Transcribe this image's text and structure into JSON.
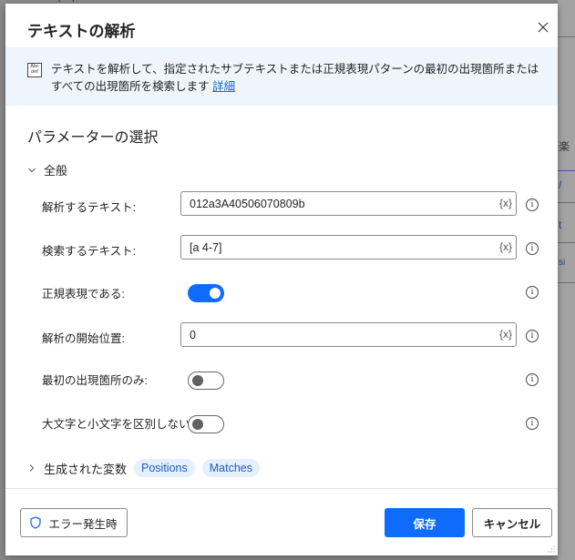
{
  "background": {
    "top_label": "[def]",
    "right_strip_texts": [
      "楽",
      "/",
      "t",
      "si"
    ]
  },
  "dialog": {
    "title": "テキストの解析",
    "close_icon": "close-icon",
    "banner": {
      "icon": "abc-def-icon",
      "icon_text_top": "Abc",
      "icon_text_bottom": "def",
      "description": "テキストを解析して、指定されたサブテキストまたは正規表現パターンの最初の出現箇所またはすべての出現箇所を検索します",
      "link_label": "詳細"
    },
    "section_title": "パラメーターの選択",
    "group": {
      "label": "全般",
      "expanded": true
    },
    "fields": {
      "text_to_parse": {
        "label": "解析するテキスト:",
        "value": "012a3A40506070809b",
        "var_button": "{x}"
      },
      "text_to_find": {
        "label": "検索するテキスト:",
        "value": "[a 4-7]",
        "var_button": "{x}"
      },
      "is_regex": {
        "label": "正規表現である:",
        "checked": true
      },
      "start_position": {
        "label": "解析の開始位置:",
        "value": "0",
        "var_button": "{x}"
      },
      "first_occurrence_only": {
        "label": "最初の出現箇所のみ:",
        "checked": false
      },
      "ignore_case": {
        "label": "大文字と小文字を区別しない:",
        "checked": false
      }
    },
    "info_glyph": "i",
    "generated_variables": {
      "label": "生成された変数",
      "expanded": false,
      "chips": [
        "Positions",
        "Matches"
      ]
    },
    "footer": {
      "error_button_label": "エラー発生時",
      "save_label": "保存",
      "cancel_label": "キャンセル"
    }
  },
  "colors": {
    "accent": "#0f6cfb",
    "banner_bg": "#eff5fc",
    "chip_bg": "#e5f0fc",
    "chip_text": "#1a5ec2",
    "link": "#0f6cbd"
  }
}
